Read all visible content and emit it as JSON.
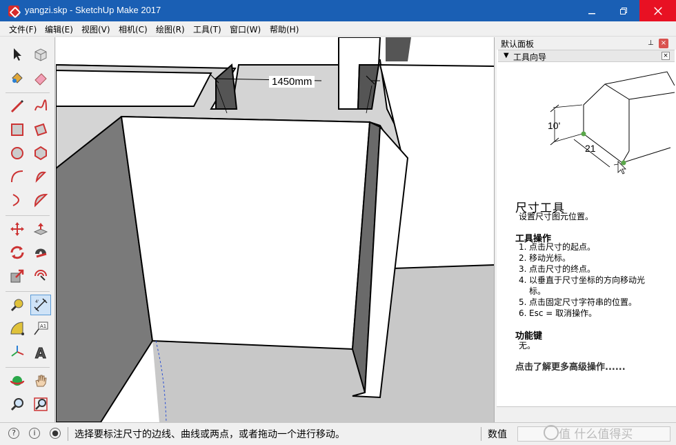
{
  "window": {
    "title": "yangzi.skp - SketchUp Make 2017",
    "colors": {
      "titlebar": "#1a5fb4",
      "close": "#e81123"
    }
  },
  "menu": {
    "items": [
      "文件(F)",
      "编辑(E)",
      "视图(V)",
      "相机(C)",
      "绘图(R)",
      "工具(T)",
      "窗口(W)",
      "帮助(H)"
    ]
  },
  "toolbar": {
    "tools": [
      "select-icon",
      "component-icon",
      "paint-bucket-icon",
      "eraser-icon",
      "pencil-line-icon",
      "freehand-icon",
      "rectangle-icon",
      "rotated-rectangle-icon",
      "circle-icon",
      "polygon-icon",
      "arc-icon",
      "pie-icon",
      "two-point-arc-icon",
      "three-point-arc-icon",
      "move-icon",
      "push-pull-icon",
      "rotate-icon",
      "follow-me-icon",
      "scale-icon",
      "offset-icon",
      "tape-measure-icon",
      "dimension-icon",
      "protractor-icon",
      "text-icon",
      "axes-icon",
      "3d-text-icon",
      "orbit-icon",
      "pan-icon",
      "zoom-icon",
      "zoom-window-icon"
    ],
    "active_tool": "dimension-icon"
  },
  "viewport": {
    "dimension_label": "1450mm"
  },
  "panel": {
    "title": "默认面板",
    "section": "工具向导",
    "illustration_labels": {
      "height": "10'",
      "width": "21"
    },
    "tool_name": "尺寸工具",
    "tool_desc": "设置尺寸图元位置。",
    "ops_heading": "工具操作",
    "steps": [
      {
        "num": "1.",
        "text": "点击尺寸的起点。"
      },
      {
        "num": "2.",
        "text": "移动光标。"
      },
      {
        "num": "3.",
        "text": "点击尺寸的终点。"
      },
      {
        "num": "4.",
        "text": "以垂直于尺寸坐标的方向移动光标。"
      },
      {
        "num": "5.",
        "text": "点击固定尺寸字符串的位置。"
      },
      {
        "num": "6.",
        "text": "Esc = 取消操作。"
      }
    ],
    "keys_heading": "功能键",
    "keys_text": "无。",
    "more_link": "点击了解更多高级操作......"
  },
  "statusbar": {
    "message": "选择要标注尺寸的边线、曲线或两点，或者拖动一个进行移动。",
    "measurements_label": "数值",
    "measurements_value": "",
    "watermark": "值 什么值得买"
  }
}
